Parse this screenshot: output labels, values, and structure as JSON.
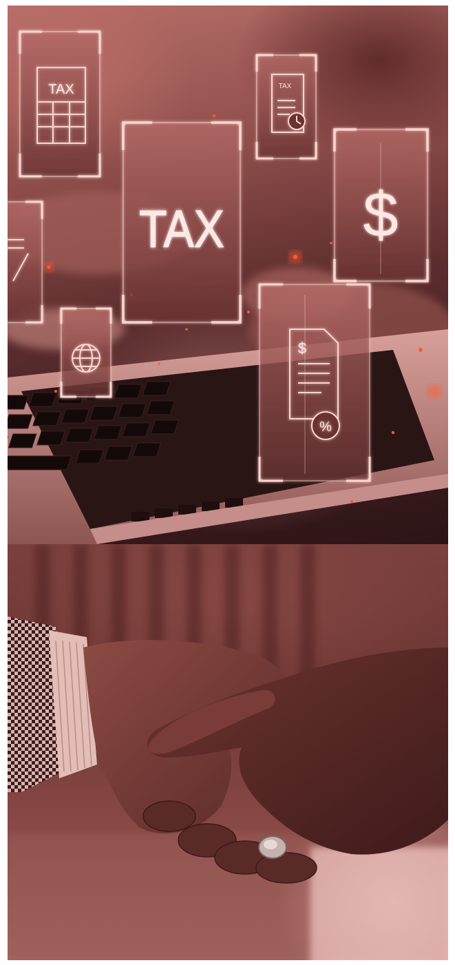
{
  "photos": [
    {
      "name": "tax-concept-photo",
      "icons": [
        "tax-form-icon",
        "tax-document-clock-icon",
        "tax-icon",
        "dollar-icon",
        "globe-icon",
        "invoice-percent-icon",
        "receipt-icon"
      ],
      "overlay_labels": {
        "tax_form": "TAX",
        "tax_doc": "TAX",
        "tax_main": "TAX",
        "dollar": "$",
        "invoice_dollar": "$",
        "invoice_percent": "%"
      }
    },
    {
      "name": "handshake-photo"
    }
  ],
  "colors": {
    "tint": "#b0625f",
    "hologram_glow": "#ffd6cf",
    "sparkle": "#ff5a2e"
  }
}
